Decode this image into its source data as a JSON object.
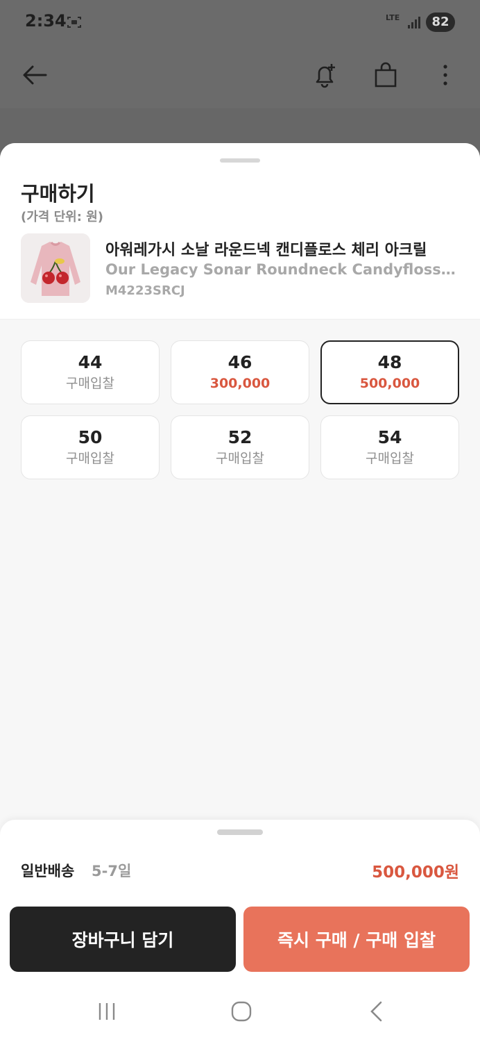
{
  "status_bar": {
    "time": "2:34",
    "network": "LTE",
    "battery": "82"
  },
  "sheet": {
    "title": "구매하기",
    "unit_note": "(가격 단위: 원)"
  },
  "product": {
    "name_ko": "아워레가시 소날 라운드넥 캔디플로스 체리 아크릴",
    "name_en": "Our Legacy Sonar Roundneck Candyfloss Ch...",
    "code": "M4223SRCJ"
  },
  "sizes": [
    {
      "size": "44",
      "sub": "구매입찰",
      "is_price": false,
      "selected": false
    },
    {
      "size": "46",
      "sub": "300,000",
      "is_price": true,
      "selected": false
    },
    {
      "size": "48",
      "sub": "500,000",
      "is_price": true,
      "selected": true
    },
    {
      "size": "50",
      "sub": "구매입찰",
      "is_price": false,
      "selected": false
    },
    {
      "size": "52",
      "sub": "구매입찰",
      "is_price": false,
      "selected": false
    },
    {
      "size": "54",
      "sub": "구매입찰",
      "is_price": false,
      "selected": false
    }
  ],
  "footer": {
    "shipping_label": "일반배송",
    "shipping_days": "5-7일",
    "total_price": "500,000원",
    "cart_button": "장바구니 담기",
    "buy_button": "즉시 구매 / 구매 입찰"
  },
  "colors": {
    "accent": "#e8735b",
    "price": "#d9573f",
    "dark_button": "#232323"
  },
  "icons": [
    "back-arrow-icon",
    "bell-plus-icon",
    "shopping-bag-icon",
    "more-vertical-icon",
    "recents-icon",
    "home-icon",
    "back-nav-icon"
  ]
}
